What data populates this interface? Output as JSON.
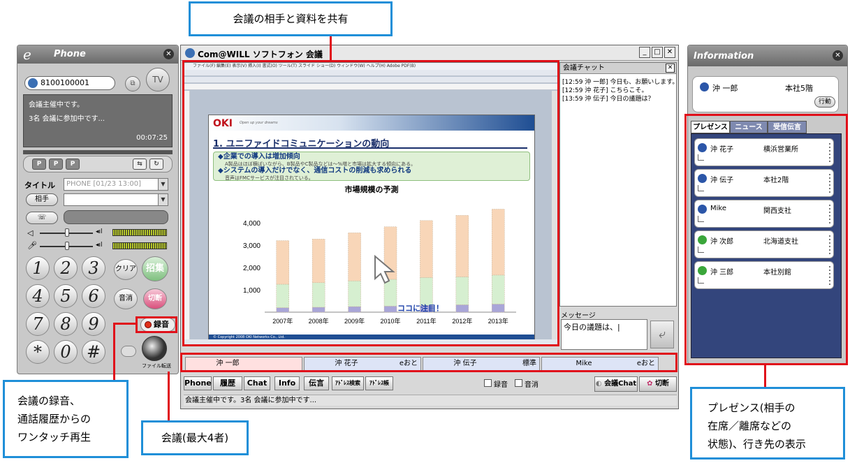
{
  "callouts": {
    "top": "会議の相手と資料を共有",
    "recording": "会議の録音、\n通話履歴からの\nワンタッチ再生",
    "conference": "会議(最大4者)",
    "presence": "プレゼンス(相手の\n在席／離席などの\n状態)、行き先の表示"
  },
  "phone": {
    "logo": "e",
    "title": "Phone",
    "number": "8100100001",
    "tv_label": "TV",
    "screen_line1": "会議主催中です。",
    "screen_line2": "3名 会議に参加中です...",
    "timer": "00:07:25",
    "title_label": "タイトル",
    "title_value": "PHONE [01/23 13:00]",
    "partner_label": "相手",
    "keys": [
      "1",
      "2",
      "3",
      "4",
      "5",
      "6",
      "7",
      "8",
      "9",
      "*",
      "0",
      "#"
    ],
    "clear": "クリア",
    "invite": "招集",
    "mute": "音消",
    "hangup": "切断",
    "record": "録音",
    "file_transfer": "ファイル転送"
  },
  "conf": {
    "title": "Com@WILL ソフトフォン 会議",
    "ppt_menu": "ファイル(F)   編集(E)   表示(V)   挿入(I)   書式(O)   ツール(T)   スライド ショー(D)   ウィンドウ(W)   ヘルプ(H)   Adobe PDF(B)",
    "slide": {
      "brand": "OKI",
      "tagline": "Open up your dreams",
      "title": "1. ユニファイドコミュニケーションの動向",
      "b1": "◆企業での導入は増加傾向",
      "b1s": "A製品はほぼ横ばいながら、B製品やC製品などは〜%増と市場は拡大する傾向にある。",
      "b2": "◆システムの導入だけでなく、通信コストの削減も求められる",
      "b2s": "音声はFMCサービスが注目されている。",
      "chart_title": "市場規模の予測",
      "note": "ココに注目！",
      "footer": "© Copyright 2008 OKI Networks Co., Ltd."
    },
    "chat_title": "会議チャット",
    "chat_lines": [
      "[12:59 沖 一郎]  今日も、お願いします。",
      "[12:59 沖 花子]  こちらこそ。",
      "[13:59 沖 伝子]  今日の議題は？"
    ],
    "message_label": "メッセージ",
    "message_text": "今日の議題は、|",
    "participants": [
      {
        "name": "沖 一郎",
        "status": ""
      },
      {
        "name": "沖 花子",
        "status": "eおと"
      },
      {
        "name": "沖 伝子",
        "status": "標準"
      },
      {
        "name": "Mike",
        "status": "eおと"
      }
    ],
    "tabs": [
      "Phone",
      "履歴",
      "Chat",
      "Info",
      "伝言",
      "ｱﾄﾞﾚｽ検索",
      "ｱﾄﾞﾚｽ帳"
    ],
    "rec_check": "録音",
    "mute_check": "音消",
    "conf_chat": "会議Chat",
    "hangup": "切断",
    "status": "会議主催中です。3名 会議に参加中です..."
  },
  "info": {
    "title": "Information",
    "me_name": "沖 一郎",
    "me_loc": "本社5階",
    "action": "行動",
    "tabs": [
      "プレゼンス",
      "ニュース",
      "受信伝言"
    ],
    "people": [
      {
        "name": "沖 花子",
        "loc": "横浜営業所",
        "color": "#2b56a8"
      },
      {
        "name": "沖 伝子",
        "loc": "本社2階",
        "color": "#2b56a8"
      },
      {
        "name": "Mike",
        "loc": "関西支社",
        "color": "#2b56a8"
      },
      {
        "name": "沖 次郎",
        "loc": "北海道支社",
        "color": "#3aa63a"
      },
      {
        "name": "沖 三郎",
        "loc": "本社別館",
        "color": "#3aa63a"
      }
    ]
  },
  "chart_data": {
    "type": "bar",
    "title": "市場規模の予測",
    "categories": [
      "2007年",
      "2008年",
      "2009年",
      "2010年",
      "2011年",
      "2012年",
      "2013年"
    ],
    "ylim": [
      0,
      5000
    ],
    "yticks": [
      "1,000",
      "2,000",
      "3,000",
      "4,000"
    ],
    "series": [
      {
        "values": [
          200,
          220,
          250,
          270,
          300,
          330,
          360
        ],
        "color": "#a9a6d8"
      },
      {
        "values": [
          1050,
          1100,
          1150,
          1200,
          1250,
          1250,
          1300
        ],
        "color": "#d6efd0"
      },
      {
        "values": [
          1950,
          1950,
          2150,
          2350,
          2550,
          2750,
          2950
        ],
        "color": "#f8d6b8"
      }
    ]
  }
}
